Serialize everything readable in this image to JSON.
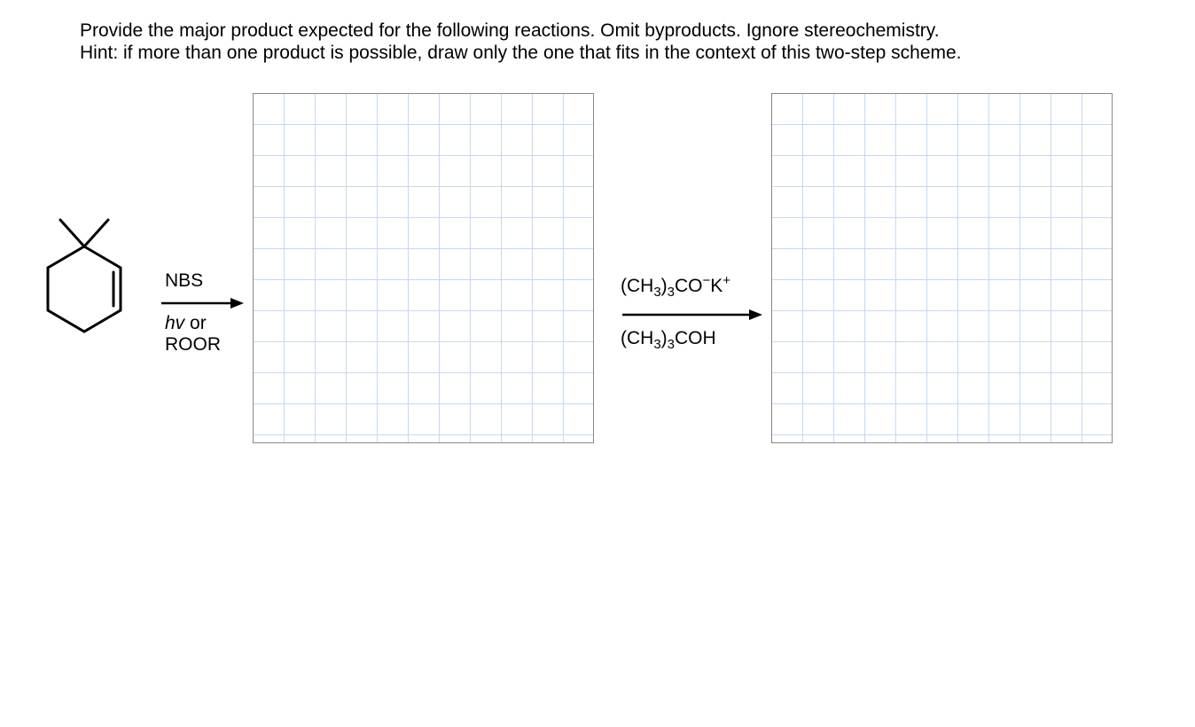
{
  "question": {
    "line1": "Provide the major product expected for the following reactions. Omit byproducts. Ignore stereochemistry.",
    "line2": "Hint: if more than one product is possible, draw only the one that fits in the context of this two-step scheme."
  },
  "reaction1": {
    "reagent_top": "NBS",
    "reagent_bottom_italic": "hv",
    "reagent_bottom_or": " or",
    "reagent_bottom_line2": "ROOR"
  },
  "reaction2": {
    "reagent_top_pre": "(CH",
    "reagent_top_sub1": "3",
    "reagent_top_mid": ")",
    "reagent_top_sub2": "3",
    "reagent_top_co": "CO",
    "reagent_top_sup1": "−",
    "reagent_top_k": "K",
    "reagent_top_sup2": "+",
    "reagent_bottom_pre": "(CH",
    "reagent_bottom_sub1": "3",
    "reagent_bottom_mid": ")",
    "reagent_bottom_sub2": "3",
    "reagent_bottom_end": "COH"
  }
}
